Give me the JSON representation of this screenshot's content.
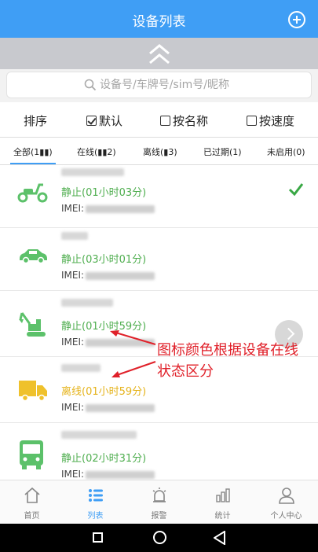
{
  "header": {
    "title": "设备列表",
    "add_icon": "plus-circle-icon"
  },
  "search": {
    "placeholder": "设备号/车牌号/sim号/昵称"
  },
  "sort": {
    "label": "排序",
    "options": [
      {
        "label": "默认",
        "checked": true
      },
      {
        "label": "按名称",
        "checked": false
      },
      {
        "label": "按速度",
        "checked": false
      }
    ]
  },
  "tabs": [
    {
      "label": "全部(1▮▮)",
      "active": true
    },
    {
      "label": "在线(▮▮2)",
      "active": false
    },
    {
      "label": "离线(▮3)",
      "active": false
    },
    {
      "label": "已过期(1)",
      "active": false
    },
    {
      "label": "未启用(0)",
      "active": false
    }
  ],
  "devices": [
    {
      "icon": "scooter-icon",
      "status": "静止(01小时03分)",
      "imei_label": "IMEI:",
      "status_color": "#4fae4f",
      "selected": true
    },
    {
      "icon": "car-icon",
      "status": "静止(03小时01分)",
      "imei_label": "IMEI:",
      "status_color": "#4fae4f"
    },
    {
      "icon": "excavator-icon",
      "status": "静止(01小时59分)",
      "imei_label": "IMEI:",
      "status_color": "#4fae4f"
    },
    {
      "icon": "truck-icon",
      "status": "离线(01小时59分)",
      "imei_label": "IMEI:",
      "status_color": "#e5b31b"
    },
    {
      "icon": "bus-icon",
      "status": "静止(02小时31分)",
      "imei_label": "IMEI:",
      "status_color": "#4fae4f"
    }
  ],
  "annotation": {
    "text": "图标颜色根据设备在线状态区分",
    "color": "#e0212a"
  },
  "tabbar": [
    {
      "label": "首页",
      "icon": "home-icon"
    },
    {
      "label": "列表",
      "icon": "list-icon",
      "active": true
    },
    {
      "label": "报警",
      "icon": "alarm-icon"
    },
    {
      "label": "统计",
      "icon": "chart-icon"
    },
    {
      "label": "个人中心",
      "icon": "user-icon"
    }
  ],
  "colors": {
    "accent": "#3f9ef5",
    "online": "#4fae4f",
    "offline": "#e5b31b"
  }
}
